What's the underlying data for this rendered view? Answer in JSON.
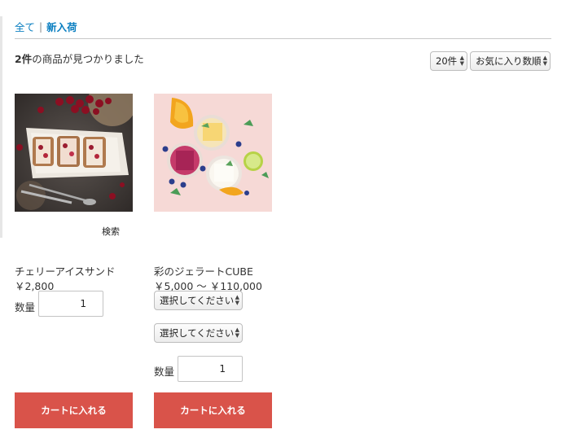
{
  "breadcrumb": {
    "all": "全て",
    "new_arrivals": "新入荷"
  },
  "result": {
    "count": "2件",
    "text": "の商品が見つかりました"
  },
  "controls": {
    "per_page": "20件",
    "sort": "お気に入り数順"
  },
  "overlay_label": "検索",
  "products": [
    {
      "name": "チェリーアイスサンド",
      "price": "￥2,800",
      "qty_label": "数量",
      "qty_value": "1",
      "cart_label": "カートに入れる"
    },
    {
      "name": "彩のジェラートCUBE",
      "price": "￥5,000 ～ ￥110,000",
      "option1": "選択してください",
      "option2": "選択してください",
      "qty_label": "数量",
      "qty_value": "1",
      "cart_label": "カートに入れる"
    }
  ]
}
